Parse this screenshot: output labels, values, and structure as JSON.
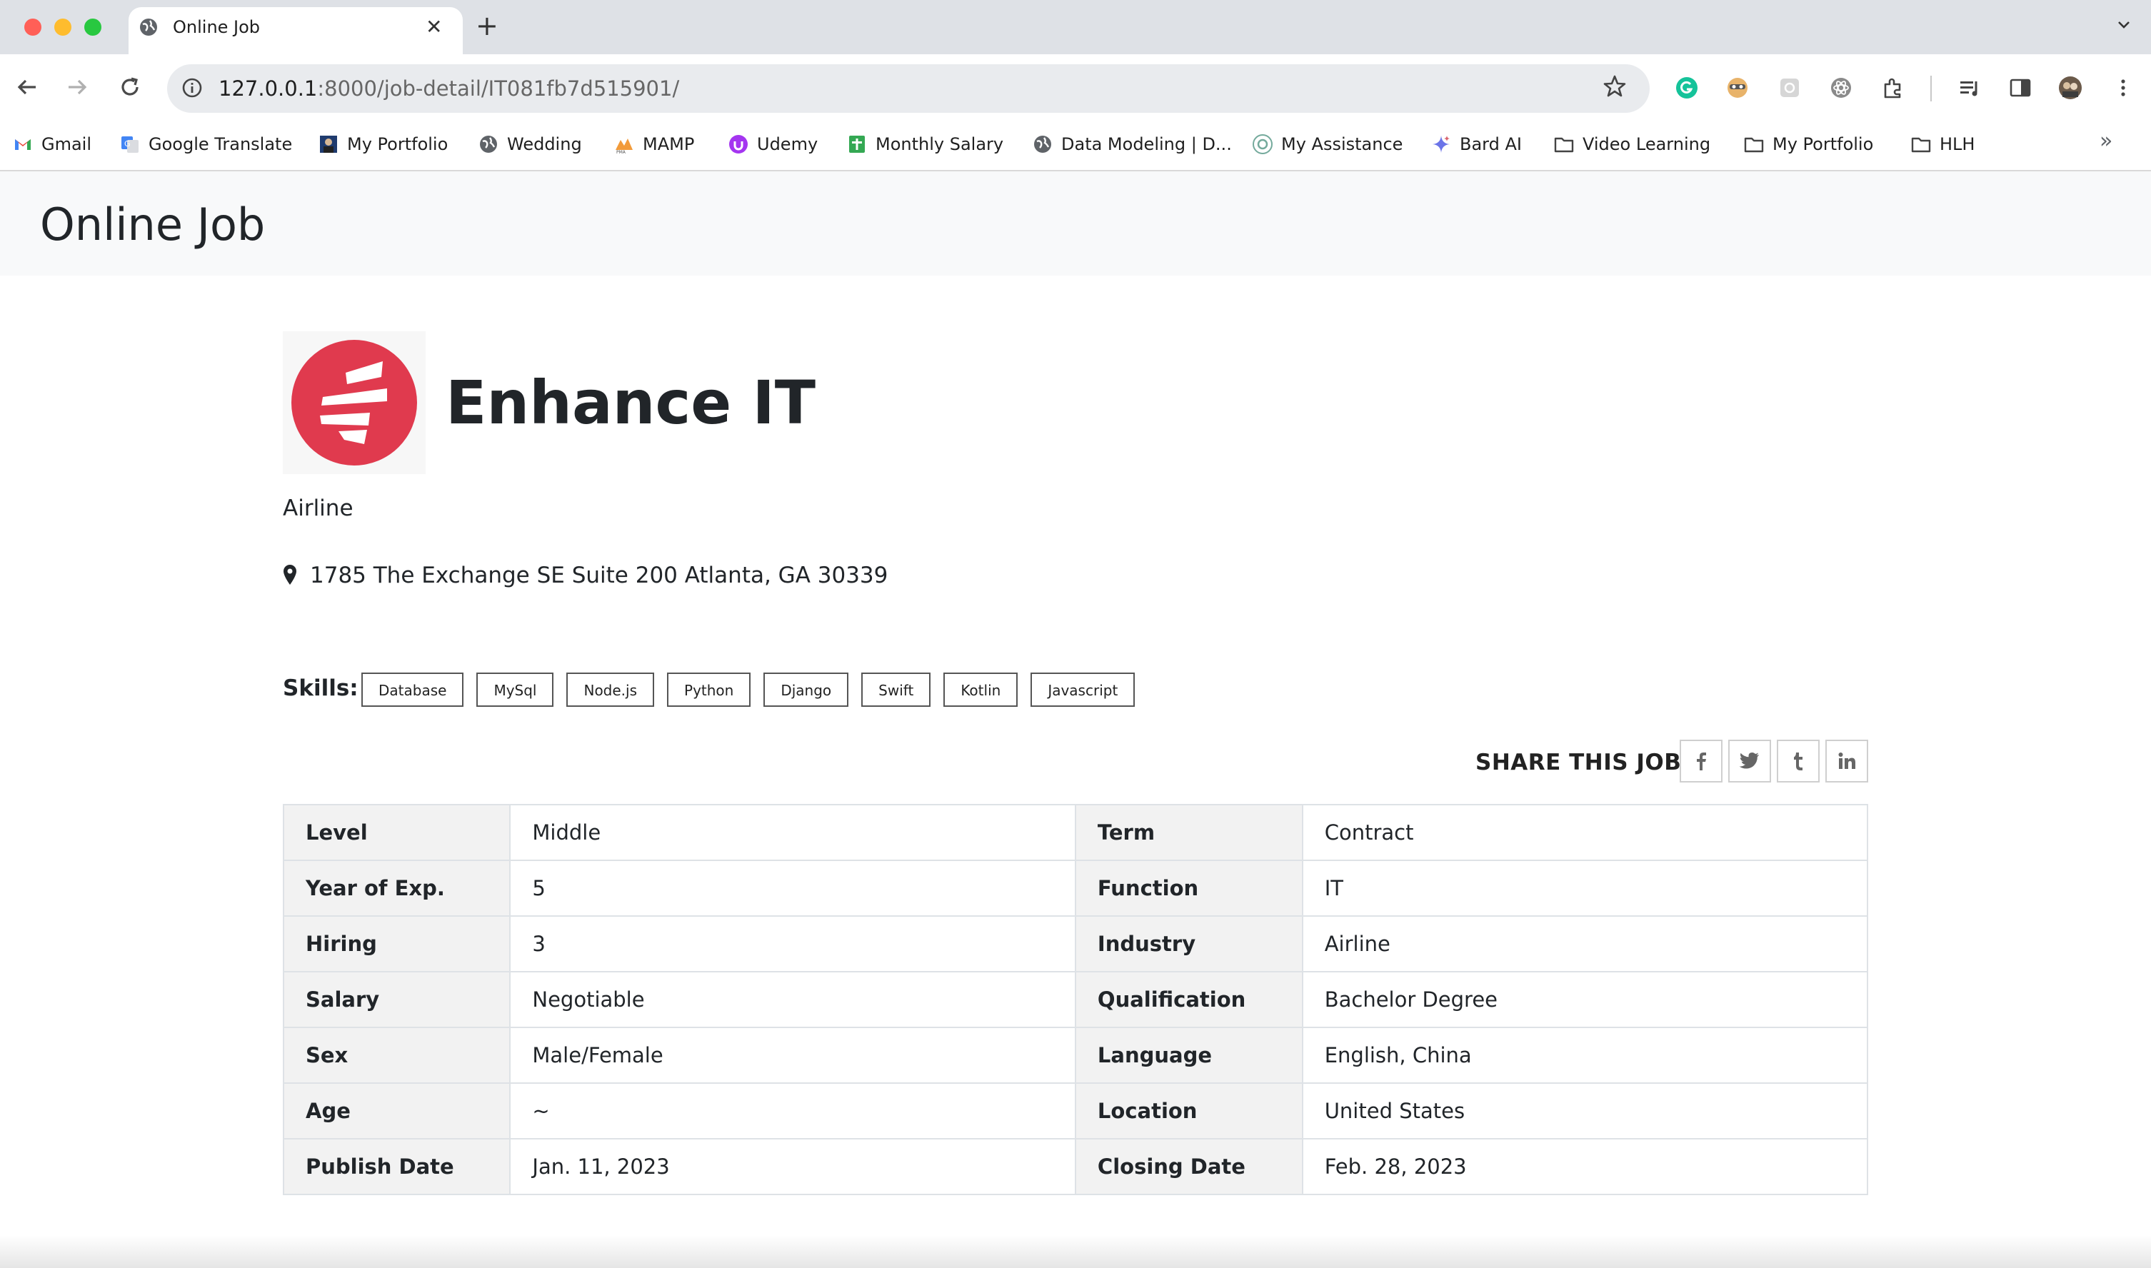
{
  "browser": {
    "tab_title": "Online Job",
    "tab_close": "✕",
    "new_tab": "+",
    "url_host": "127.0.0.1",
    "url_rest": ":8000/job-detail/IT081fb7d515901/",
    "bookmarks": [
      {
        "label": "Gmail",
        "icon": "gmail-icon"
      },
      {
        "label": "Google Translate",
        "icon": "translate-icon"
      },
      {
        "label": "My Portfolio",
        "icon": "portfolio-icon"
      },
      {
        "label": "Wedding",
        "icon": "globe-icon"
      },
      {
        "label": "MAMP",
        "icon": "mamp-icon"
      },
      {
        "label": "Udemy",
        "icon": "udemy-icon"
      },
      {
        "label": "Monthly Salary",
        "icon": "sheets-icon"
      },
      {
        "label": "Data Modeling | D...",
        "icon": "globe-icon"
      },
      {
        "label": "My Assistance",
        "icon": "openai-icon"
      },
      {
        "label": "Bard AI",
        "icon": "bard-icon"
      },
      {
        "label": "Video Learning",
        "icon": "folder-icon"
      },
      {
        "label": "My Portfolio",
        "icon": "folder-icon"
      },
      {
        "label": "HLH",
        "icon": "folder-icon"
      }
    ],
    "more_bookmarks": "»"
  },
  "site": {
    "brand": "Online Job"
  },
  "company": {
    "name": "Enhance IT",
    "industry": "Airline",
    "address": "1785 The Exchange SE Suite 200 Atlanta, GA 30339",
    "logo_color": "#e03a4e"
  },
  "skills": {
    "label": "Skills:",
    "items": [
      "Database",
      "MySql",
      "Node.js",
      "Python",
      "Django",
      "Swift",
      "Kotlin",
      "Javascript"
    ]
  },
  "share": {
    "label": "SHARE THIS JOB",
    "icons": [
      "facebook-icon",
      "twitter-icon",
      "tumblr-icon",
      "linkedin-icon"
    ]
  },
  "specs": [
    {
      "k1": "Level",
      "v1": "Middle",
      "k2": "Term",
      "v2": "Contract"
    },
    {
      "k1": "Year of Exp.",
      "v1": "5",
      "k2": "Function",
      "v2": "IT"
    },
    {
      "k1": "Hiring",
      "v1": "3",
      "k2": "Industry",
      "v2": "Airline"
    },
    {
      "k1": "Salary",
      "v1": "Negotiable",
      "k2": "Qualification",
      "v2": "Bachelor Degree"
    },
    {
      "k1": "Sex",
      "v1": "Male/Female",
      "k2": "Language",
      "v2": "English, China"
    },
    {
      "k1": "Age",
      "v1": "~",
      "k2": "Location",
      "v2": "United States"
    },
    {
      "k1": "Publish Date",
      "v1": "Jan. 11, 2023",
      "k2": "Closing Date",
      "v2": "Feb. 28, 2023"
    }
  ]
}
